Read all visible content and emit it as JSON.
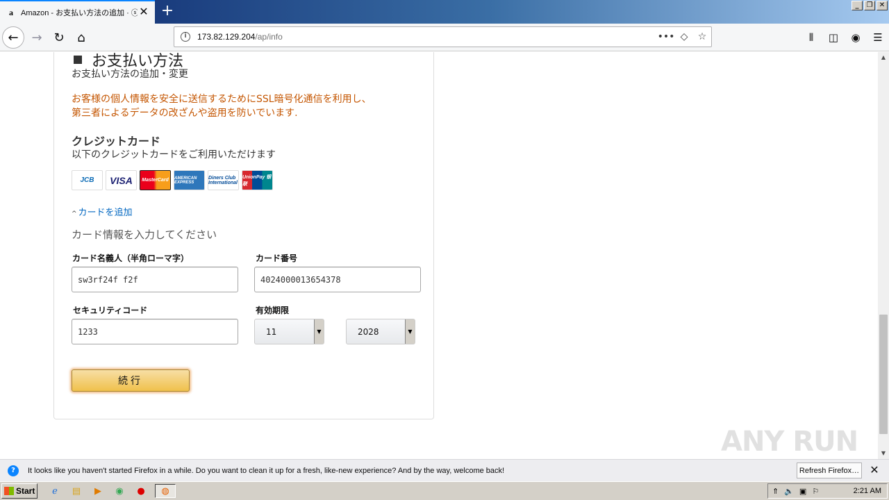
{
  "browser": {
    "tab_title": "Amazon - お支払い方法の追加 · ⓢ",
    "tab_favicon": "a",
    "url_host": "173.82.129.204",
    "url_path": "/ap/info"
  },
  "page": {
    "section_title": "お支払い方法",
    "subtitle": "お支払い方法の追加・変更",
    "ssl_note_line1": "お客様の個人情報を安全に送信するためにSSL暗号化通信を利用し、",
    "ssl_note_line2": "第三者によるデータの改ざんや盗用を防いでいます.",
    "cc_title": "クレジットカード",
    "cc_desc": "以下のクレジットカードをご利用いただけます",
    "brands": [
      "JCB",
      "VISA",
      "MasterCard",
      "AMERICAN EXPRESS",
      "Diners Club International",
      "UnionPay 银联"
    ],
    "add_card": "カードを追加",
    "enter_info": "カード情報を入力してください",
    "fields": {
      "name_label": "カード名義人（半角ローマ字）",
      "name_value": "sw3rf24f f2f",
      "number_label": "カード番号",
      "number_value": "4024000013654378",
      "cvv_label": "セキュリティコード",
      "cvv_value": "1233",
      "expiry_label": "有効期限",
      "expiry_month": "11",
      "expiry_year": "2028"
    },
    "continue_label": "続行",
    "watermark": "ANY RUN"
  },
  "notification": {
    "message": "It looks like you haven't started Firefox in a while. Do you want to clean it up for a fresh, like-new experience? And by the way, welcome back!",
    "button": "Refresh Firefox…"
  },
  "taskbar": {
    "start_label": "Start",
    "clock": "2:21 AM"
  },
  "colors": {
    "ssl_note": "#c45500",
    "link": "#0066c0",
    "button": "#f0c14b"
  }
}
